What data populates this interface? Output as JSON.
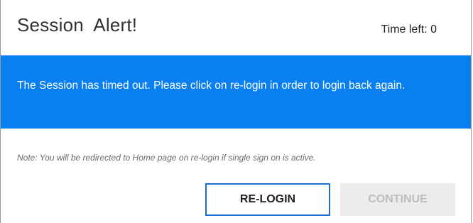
{
  "dialog": {
    "title": "Session  Alert!",
    "time_left": "Time left: 0"
  },
  "alert": {
    "message": "The Session has timed out. Please click on re-login in order to login back again."
  },
  "note": "Note: You will be redirected to Home page on re-login if single sign on is active.",
  "buttons": {
    "relogin": "RE-LOGIN",
    "continue": "CONTINUE",
    "continue_disabled": true
  },
  "colors": {
    "banner": "#0a7ff2",
    "relogin_border": "#1b6fd0",
    "continue_bg": "#ececec"
  }
}
